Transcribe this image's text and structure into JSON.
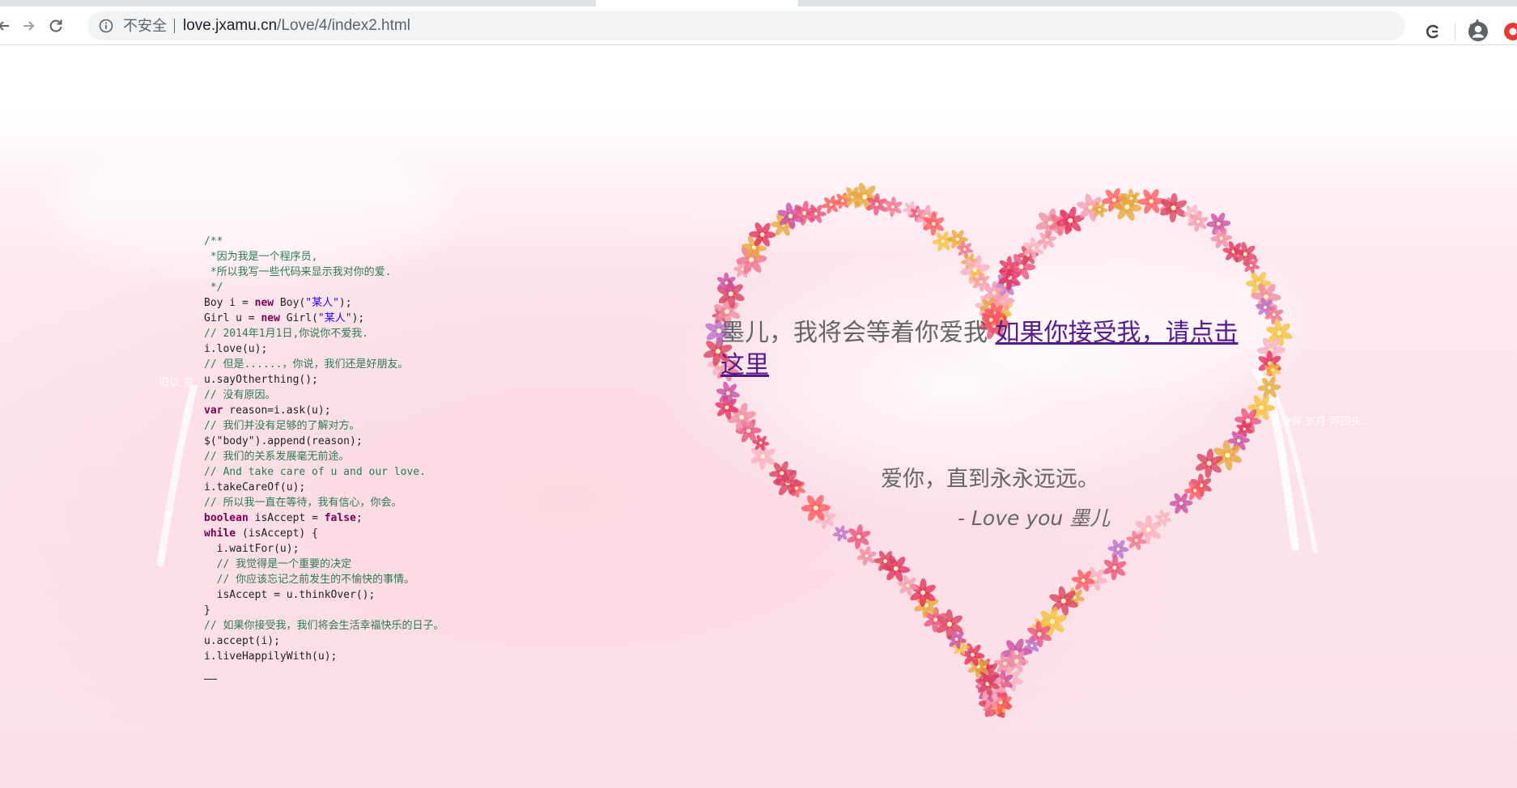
{
  "browser": {
    "security_label": "不安全",
    "url_host": "love.jxamu.cn",
    "url_path": "/Love/4/index2.html"
  },
  "code": {
    "lines": [
      [
        {
          "t": "/**",
          "c": "cm"
        }
      ],
      [
        {
          "t": " *因为我是一个程序员,",
          "c": "cm"
        }
      ],
      [
        {
          "t": " *所以我写一些代码来显示我对你的爱.",
          "c": "cm"
        }
      ],
      [
        {
          "t": " */",
          "c": "cm"
        }
      ],
      [
        {
          "t": "Boy i = ",
          "c": ""
        },
        {
          "t": "new",
          "c": "kw"
        },
        {
          "t": " Boy(",
          "c": ""
        },
        {
          "t": "\"某人\"",
          "c": "str"
        },
        {
          "t": ");",
          "c": ""
        }
      ],
      [
        {
          "t": "Girl u = ",
          "c": ""
        },
        {
          "t": "new",
          "c": "kw"
        },
        {
          "t": " Girl(",
          "c": ""
        },
        {
          "t": "\"某人\"",
          "c": "str"
        },
        {
          "t": ");",
          "c": ""
        }
      ],
      [
        {
          "t": "// 2014年1月1日,你说你不爱我.",
          "c": "cm"
        }
      ],
      [
        {
          "t": "i.love(u);",
          "c": ""
        }
      ],
      [
        {
          "t": "// 但是......，你说，我们还是好朋友。",
          "c": "cm"
        }
      ],
      [
        {
          "t": "u.sayOtherthing();",
          "c": ""
        }
      ],
      [
        {
          "t": "// 没有原因。",
          "c": "cm"
        }
      ],
      [
        {
          "t": "var",
          "c": "kw"
        },
        {
          "t": " reason=i.ask(u);",
          "c": ""
        }
      ],
      [
        {
          "t": "// 我们并没有足够的了解对方。",
          "c": "cm"
        }
      ],
      [
        {
          "t": "$(\"body\").append(reason);",
          "c": ""
        }
      ],
      [
        {
          "t": "// 我们的关系发展毫无前途。",
          "c": "cm"
        }
      ],
      [
        {
          "t": "// And take care of u and our love.",
          "c": "cm"
        }
      ],
      [
        {
          "t": "i.takeCareOf(u);",
          "c": ""
        }
      ],
      [
        {
          "t": "// 所以我一直在等待，我有信心，你会。",
          "c": "cm"
        }
      ],
      [
        {
          "t": "boolean",
          "c": "kw"
        },
        {
          "t": " isAccept = ",
          "c": ""
        },
        {
          "t": "false",
          "c": "kw"
        },
        {
          "t": ";",
          "c": ""
        }
      ],
      [
        {
          "t": "while",
          "c": "kw"
        },
        {
          "t": " (isAccept) {",
          "c": ""
        }
      ],
      [
        {
          "t": "  i.waitFor(u);",
          "c": ""
        }
      ],
      [
        {
          "t": "  // 我觉得是一个重要的决定",
          "c": "cm"
        }
      ],
      [
        {
          "t": "  // 你应该忘记之前发生的不愉快的事情。",
          "c": "cm"
        }
      ],
      [
        {
          "t": "  isAccept = u.thinkOver();",
          "c": ""
        }
      ],
      [
        {
          "t": "}",
          "c": ""
        }
      ],
      [
        {
          "t": "// 如果你接受我，我们将会生活幸福快乐的日子。",
          "c": "cm"
        }
      ],
      [
        {
          "t": "u.accept(i);",
          "c": ""
        }
      ],
      [
        {
          "t": "i.liveHappilyWith(u);",
          "c": ""
        }
      ]
    ]
  },
  "message": {
    "text": "墨儿，我将会等着你爱我 ",
    "link": "如果你接受我，请点击这里",
    "forever": "爱你，直到永永远远。",
    "signature": "- Love you 墨儿"
  },
  "faint_text": {
    "left": "旧以  前  ·",
    "right": "没有  岁月  可回头..."
  },
  "colors": {
    "flower_palette": [
      "#e8507a",
      "#f26f8d",
      "#f59bb0",
      "#c94aa0",
      "#e6a63a",
      "#f4c23c",
      "#ff5a5f",
      "#d8405e",
      "#b86fc8",
      "#f08aa0",
      "#e2305b",
      "#fbb0c0"
    ]
  }
}
